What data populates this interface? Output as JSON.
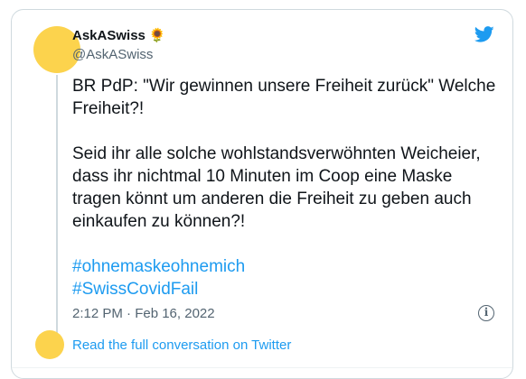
{
  "tweet": {
    "display_name": "AskASwiss",
    "name_emoji": "🌻",
    "handle": "@AskASwiss",
    "paragraphs": [
      "BR PdP: \"Wir gewinnen unsere Freiheit zurück\" Welche Freiheit?!",
      "Seid ihr alle solche wohlstandsverwöhnten Weicheier, dass ihr nichtmal 10 Minuten im Coop eine Maske tragen könnt um anderen die Freiheit zu geben auch einkaufen zu können?!"
    ],
    "hashtags": [
      "#ohnemaskeohnemich",
      "#SwissCovidFail"
    ],
    "timestamp": "2:12 PM · Feb 16, 2022",
    "read_more": "Read the full conversation on Twitter"
  },
  "icons": {
    "brand": "twitter-bird-icon",
    "info": "info-icon"
  },
  "colors": {
    "avatar": "#fcd34d",
    "link": "#1d9bf0",
    "text": "#0f1419",
    "muted": "#536471",
    "border": "#cfd9de"
  }
}
